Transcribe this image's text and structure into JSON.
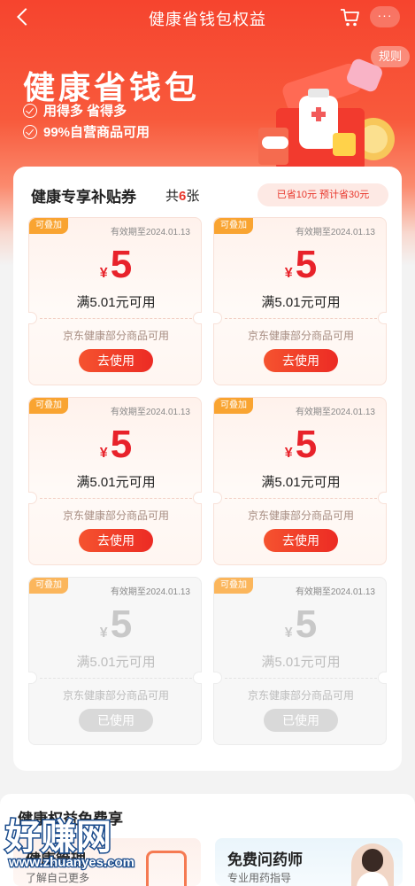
{
  "nav": {
    "title": "健康省钱包权益",
    "more_label": "···"
  },
  "hero": {
    "rules_label": "规则",
    "title": "健康省钱包",
    "features": [
      "用得多 省得多",
      "99%自营商品可用"
    ]
  },
  "coupons_section": {
    "title": "健康专享补贴券",
    "count_prefix": "共",
    "count": "6",
    "count_suffix": "张",
    "savings": "已省10元  预计省30元"
  },
  "coupons": [
    {
      "tag": "可叠加",
      "expiry": "有效期至2024.01.13",
      "currency": "¥",
      "amount": "5",
      "condition": "满5.01元可用",
      "scope": "京东健康部分商品可用",
      "action": "去使用",
      "used": false
    },
    {
      "tag": "可叠加",
      "expiry": "有效期至2024.01.13",
      "currency": "¥",
      "amount": "5",
      "condition": "满5.01元可用",
      "scope": "京东健康部分商品可用",
      "action": "去使用",
      "used": false
    },
    {
      "tag": "可叠加",
      "expiry": "有效期至2024.01.13",
      "currency": "¥",
      "amount": "5",
      "condition": "满5.01元可用",
      "scope": "京东健康部分商品可用",
      "action": "去使用",
      "used": false
    },
    {
      "tag": "可叠加",
      "expiry": "有效期至2024.01.13",
      "currency": "¥",
      "amount": "5",
      "condition": "满5.01元可用",
      "scope": "京东健康部分商品可用",
      "action": "去使用",
      "used": false
    },
    {
      "tag": "可叠加",
      "expiry": "有效期至2024.01.13",
      "currency": "¥",
      "amount": "5",
      "condition": "满5.01元可用",
      "scope": "京东健康部分商品可用",
      "action": "已使用",
      "used": true
    },
    {
      "tag": "可叠加",
      "expiry": "有效期至2024.01.13",
      "currency": "¥",
      "amount": "5",
      "condition": "满5.01元可用",
      "scope": "京东健康部分商品可用",
      "action": "已使用",
      "used": true
    }
  ],
  "benefits": {
    "title": "健康权益免费享",
    "cards": [
      {
        "title": "健康管理",
        "subtitle": "了解自己更多"
      },
      {
        "title": "免费问药师",
        "subtitle": "专业用药指导"
      }
    ]
  },
  "watermark": {
    "logo": "好赚网",
    "url": "www.zhuanyes.com"
  },
  "colors": {
    "brand_red": "#e8222a",
    "hero_orange": "#f6442e",
    "tag_orange": "#f9a431"
  }
}
